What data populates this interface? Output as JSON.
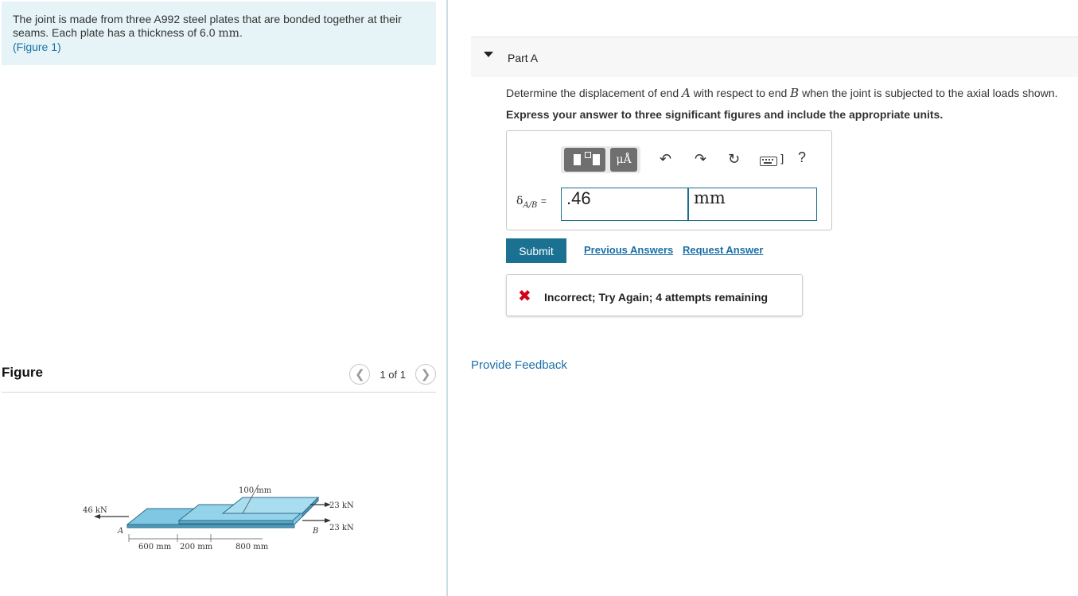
{
  "problem": {
    "text_1": "The joint is made from three A992 steel plates that are bonded together at their seams. Each plate has a thickness of 6.0",
    "unit": "mm",
    "text_2": ".",
    "figure_link": "(Figure 1)"
  },
  "figure": {
    "title": "Figure",
    "pager": "1 of 1",
    "prev_icon": "chevron-left-icon",
    "next_icon": "chevron-right-icon",
    "labels": {
      "load_left": "46 kN",
      "point_a": "A",
      "point_b": "B",
      "width": "100 mm",
      "load_top_right": "23 kN",
      "load_bottom_right": "23 kN",
      "len_1": "600 mm",
      "len_2": "200 mm",
      "len_3": "800 mm"
    }
  },
  "part": {
    "title": "Part A",
    "question_1": "Determine the displacement of end",
    "var_a": "A",
    "question_2": "with respect to end",
    "var_b": "B",
    "question_3": "when the joint is subjected to the axial loads shown.",
    "instruction": "Express your answer to three significant figures and include the appropriate units."
  },
  "answer": {
    "label_symbol": "δ",
    "label_sub": "A/B",
    "label_eq": "=",
    "value": ".46",
    "unit": "mm",
    "toolbar": {
      "units_label": "μÅ",
      "undo_icon": "undo-icon",
      "redo_icon": "redo-icon",
      "reset_icon": "reset-icon",
      "keyboard_icon": "keyboard-icon",
      "help_label": "?"
    }
  },
  "actions": {
    "submit": "Submit",
    "previous_answers": "Previous Answers",
    "request_answer": "Request Answer"
  },
  "feedback": {
    "message": "Incorrect; Try Again; 4 attempts remaining",
    "provide_feedback": "Provide Feedback"
  },
  "colors": {
    "problem_bg": "#e6f4f7",
    "accent": "#1a7191",
    "link": "#1a6fa8",
    "error": "#d0021b",
    "plate": "#7fc7e3"
  }
}
